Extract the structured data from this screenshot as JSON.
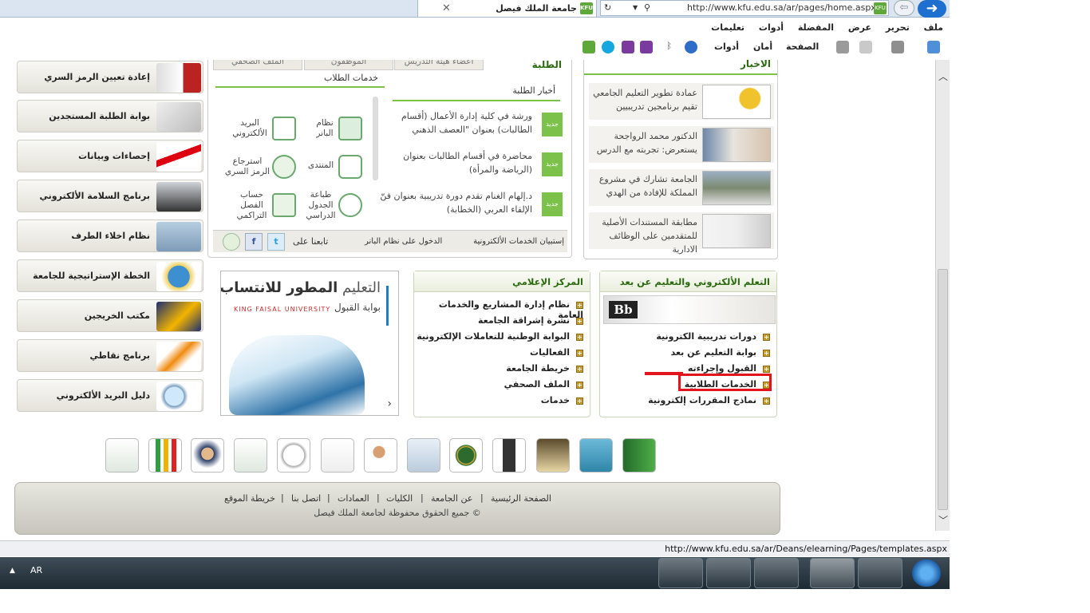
{
  "browser": {
    "tab_title": "جامعة الملك فيصل",
    "tab_badge": "KFU",
    "url": "http://www.kfu.edu.sa/ar/pages/home.aspx",
    "menu": [
      "ملف",
      "تحرير",
      "عرض",
      "المفضلة",
      "أدوات",
      "تعليمات"
    ],
    "command": [
      "الصفحة",
      "أمان",
      "أدوات"
    ]
  },
  "sidebar": {
    "items": [
      {
        "label": "إعادة تعيين الرمز السري",
        "icon": "lock-icon"
      },
      {
        "label": "بوابة الطلبة المستجدين",
        "icon": "dice-icon"
      },
      {
        "label": "إحصاءات وبيانات",
        "icon": "chart-arrow-icon"
      },
      {
        "label": "برنامج السلامة الألكتروني",
        "icon": "firefighter-icon"
      },
      {
        "label": "نظام اخلاء الطرف",
        "icon": "handshake-icon"
      },
      {
        "label": "الخطة الإستراتيجية للجامعة",
        "icon": "globe-icon"
      },
      {
        "label": "مكتب الخريجين",
        "icon": "graduate-icon"
      },
      {
        "label": "برنامج نقاطي",
        "icon": "runner-icon"
      },
      {
        "label": "دليل البريد الألكتروني",
        "icon": "search-magnifier-icon"
      }
    ]
  },
  "top_tabs": {
    "students": "الطلبة",
    "faculty": "أعضاء هيئة التدريس",
    "staff": "الموظفون",
    "press": "الملف الصحفي"
  },
  "student_news": {
    "heading": "أخبار الطلبة",
    "badge": "جديد",
    "items": [
      "ورشة في كلية إدارة الأعمال (أقسام الطالبات) بعنوان \"العصف الذهني",
      "محاضرة في أقسام الطالبات بعنوان (الرياضة والمرأة)",
      "د.إلهام الغنام تقدم دورة تدريبية بعنوان فنّ الإلقاء العربي (الخطابة)"
    ]
  },
  "student_services": {
    "heading": "خدمات الطلاب",
    "items": [
      {
        "label": "نظام البانر",
        "icon": "monitor-icon"
      },
      {
        "label": "البريد الألكتروني",
        "icon": "mail-icon"
      },
      {
        "label": "المنتدى",
        "icon": "chat-bubble-icon"
      },
      {
        "label": "استرجاع الرمز السري",
        "icon": "key-icon"
      },
      {
        "label": "طباعة الجدول الدراسي",
        "icon": "clock-icon"
      },
      {
        "label": "حساب الفصل التراكمي",
        "icon": "calculator-icon"
      }
    ],
    "footer_links": [
      "إستبيان الخدمات الألكترونية",
      "الدخول على نظام البانر"
    ],
    "follow_label": "تابعنا على"
  },
  "news": {
    "heading": "الأخبار",
    "items": [
      "عمادة تطوير التعليم الجامعي تقيم برنامجين تدريبيين",
      "الدكتور محمد الرواجحة يستعرض: تجربته مع الدرس",
      "الجامعة تشارك في مشروع المملكة للإفادة من الهدي",
      "مطابقة المستندات الأصلية للمتقدمين على الوظائف الادارية"
    ]
  },
  "elearning": {
    "heading": "التعلم الألكتروني والتعليم عن بعد",
    "banner_text": "Bb",
    "items": [
      "دورات تدريبية الكترونية",
      "بوابة التعليم عن بعد",
      "القبول وإجراءته",
      "الخدمات الطلابية",
      "نماذج المقررات إلكترونية"
    ]
  },
  "media": {
    "heading": "المركز الإعلامي",
    "items": [
      "نظام إدارة المشاريع والخدمات العامة",
      "نشرة إشراقة الجامعة",
      "البوابة الوطنية للتعاملات الإلكترونية",
      "الفعاليات",
      "خريطة الجامعة",
      "الملف الصحفي",
      "خدمات"
    ]
  },
  "promo": {
    "title_light": "التعليم",
    "title_bold": "المطور للانتساب",
    "university": "KING FAISAL UNIVERSITY",
    "subtitle": "بوابة القبول"
  },
  "footer": {
    "links": [
      "الصفحة الرئيسية",
      "عن الجامعة",
      "الكليات",
      "العمادات",
      "اتصل بنا",
      "خريطة الموقع"
    ],
    "copyright": "© جميع الحقوق محفوظة لجامعة الملك فيصل"
  },
  "status": {
    "url": "http://www.kfu.edu.sa/ar/Deans/elearning/Pages/templates.aspx"
  },
  "taskbar": {
    "lang": "AR"
  },
  "colors": {
    "panel_heading": "#2b6a0f",
    "highlight": "#e2151d",
    "taskbar": "#26333d"
  }
}
